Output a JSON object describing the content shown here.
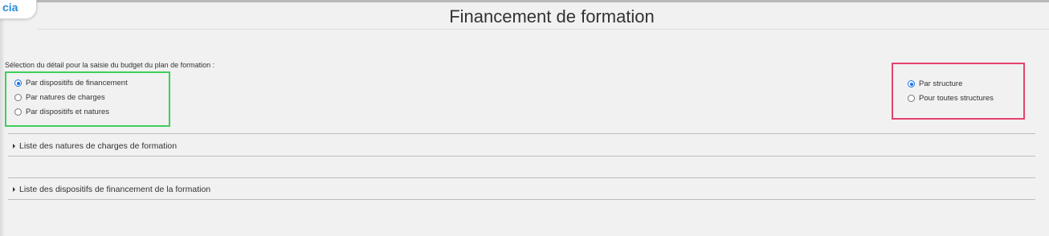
{
  "brand": {
    "logo_text": "cia"
  },
  "page": {
    "title": "Financement de formation"
  },
  "budget_detail": {
    "label": "Sélection du détail pour la saisie du budget du plan de formation :",
    "options": [
      {
        "label": "Par dispositifs de financement",
        "checked": true
      },
      {
        "label": "Par natures de charges",
        "checked": false
      },
      {
        "label": "Par dispositifs et natures",
        "checked": false
      }
    ]
  },
  "scope": {
    "options": [
      {
        "label": "Par structure",
        "checked": true
      },
      {
        "label": "Pour toutes structures",
        "checked": false
      }
    ]
  },
  "sections": [
    {
      "label": "Liste des natures de charges de formation",
      "expanded": false
    },
    {
      "label": "Liste des dispositifs de financement de la formation",
      "expanded": false
    }
  ],
  "colors": {
    "highlight_left": "#3ecf5a",
    "highlight_right": "#e3426e",
    "radio_accent": "#1a73e8",
    "logo": "#2a8fd6"
  }
}
